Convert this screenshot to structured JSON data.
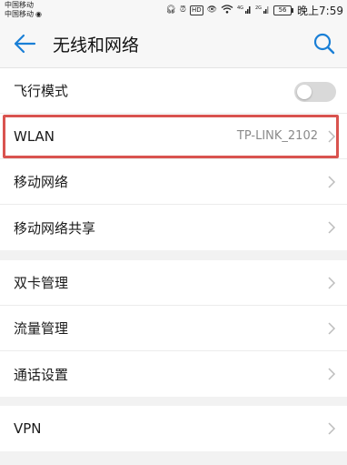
{
  "statusbar": {
    "carrier1": "中国移动",
    "carrier2": "中国移动",
    "carrier_data_badge": "4",
    "hd": "HD",
    "sig1_label": "4G",
    "sig2_label": "2G",
    "battery": "56",
    "time": "晚上7:59"
  },
  "header": {
    "title": "无线和网络"
  },
  "group1": {
    "airplane_label": "飞行模式",
    "airplane_on": false,
    "wlan_label": "WLAN",
    "wlan_value": "TP-LINK_2102",
    "mobile_network_label": "移动网络",
    "tethering_label": "移动网络共享"
  },
  "group2": {
    "dual_sim_label": "双卡管理",
    "data_usage_label": "流量管理",
    "call_settings_label": "通话设置"
  },
  "group3": {
    "vpn_label": "VPN"
  },
  "colors": {
    "accent": "#1a7fd6",
    "highlight": "#d9534f"
  }
}
